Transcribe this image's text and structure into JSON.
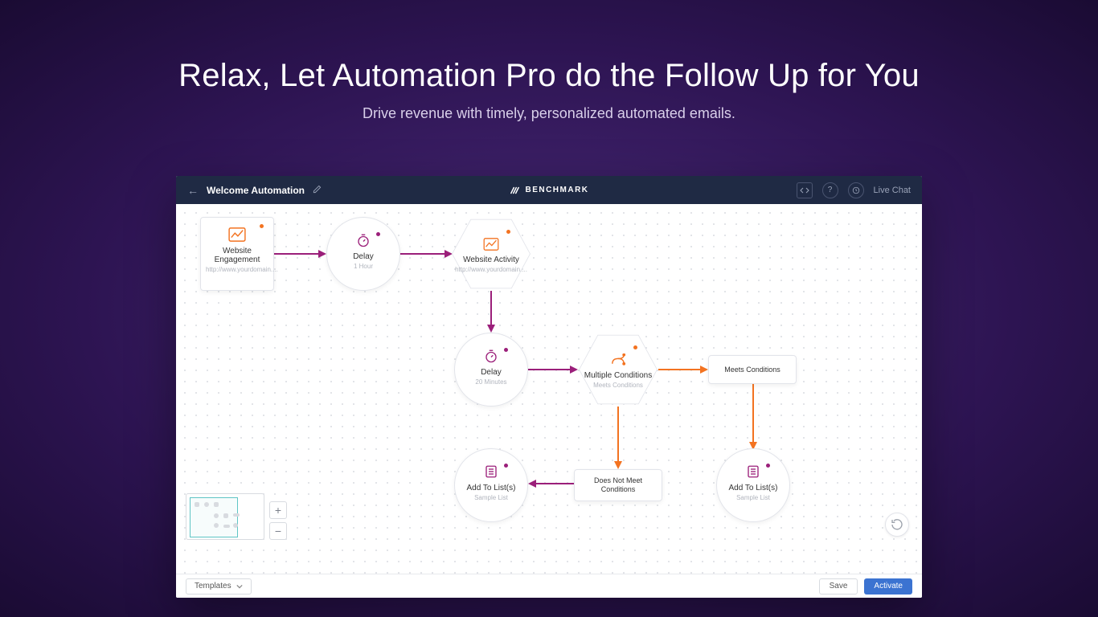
{
  "hero": {
    "title": "Relax, Let Automation Pro do the Follow Up for You",
    "subtitle": "Drive revenue with timely, personalized automated emails."
  },
  "header": {
    "automation_name": "Welcome Automation",
    "brand": "BENCHMARK",
    "live_chat": "Live Chat"
  },
  "nodes": {
    "website_engagement": {
      "title": "Website Engagement",
      "sub": "http://www.yourdomain...."
    },
    "delay1": {
      "title": "Delay",
      "sub": "1 Hour"
    },
    "website_activity": {
      "title": "Website Activity",
      "sub": "http://www.yourdomain...."
    },
    "delay2": {
      "title": "Delay",
      "sub": "20 Minutes"
    },
    "multiple_conditions": {
      "title": "Multiple Conditions",
      "sub": "Meets Conditions"
    },
    "meets_conditions": {
      "title": "Meets Conditions"
    },
    "does_not_meet": {
      "title": "Does Not Meet Conditions"
    },
    "add_to_list1": {
      "title": "Add To List(s)",
      "sub": "Sample List"
    },
    "add_to_list2": {
      "title": "Add To List(s)",
      "sub": "Sample List"
    }
  },
  "footer": {
    "templates": "Templates",
    "save": "Save",
    "activate": "Activate"
  },
  "colors": {
    "purple": "#9b1f7a",
    "orange": "#f37321",
    "blue": "#3b73d1"
  }
}
